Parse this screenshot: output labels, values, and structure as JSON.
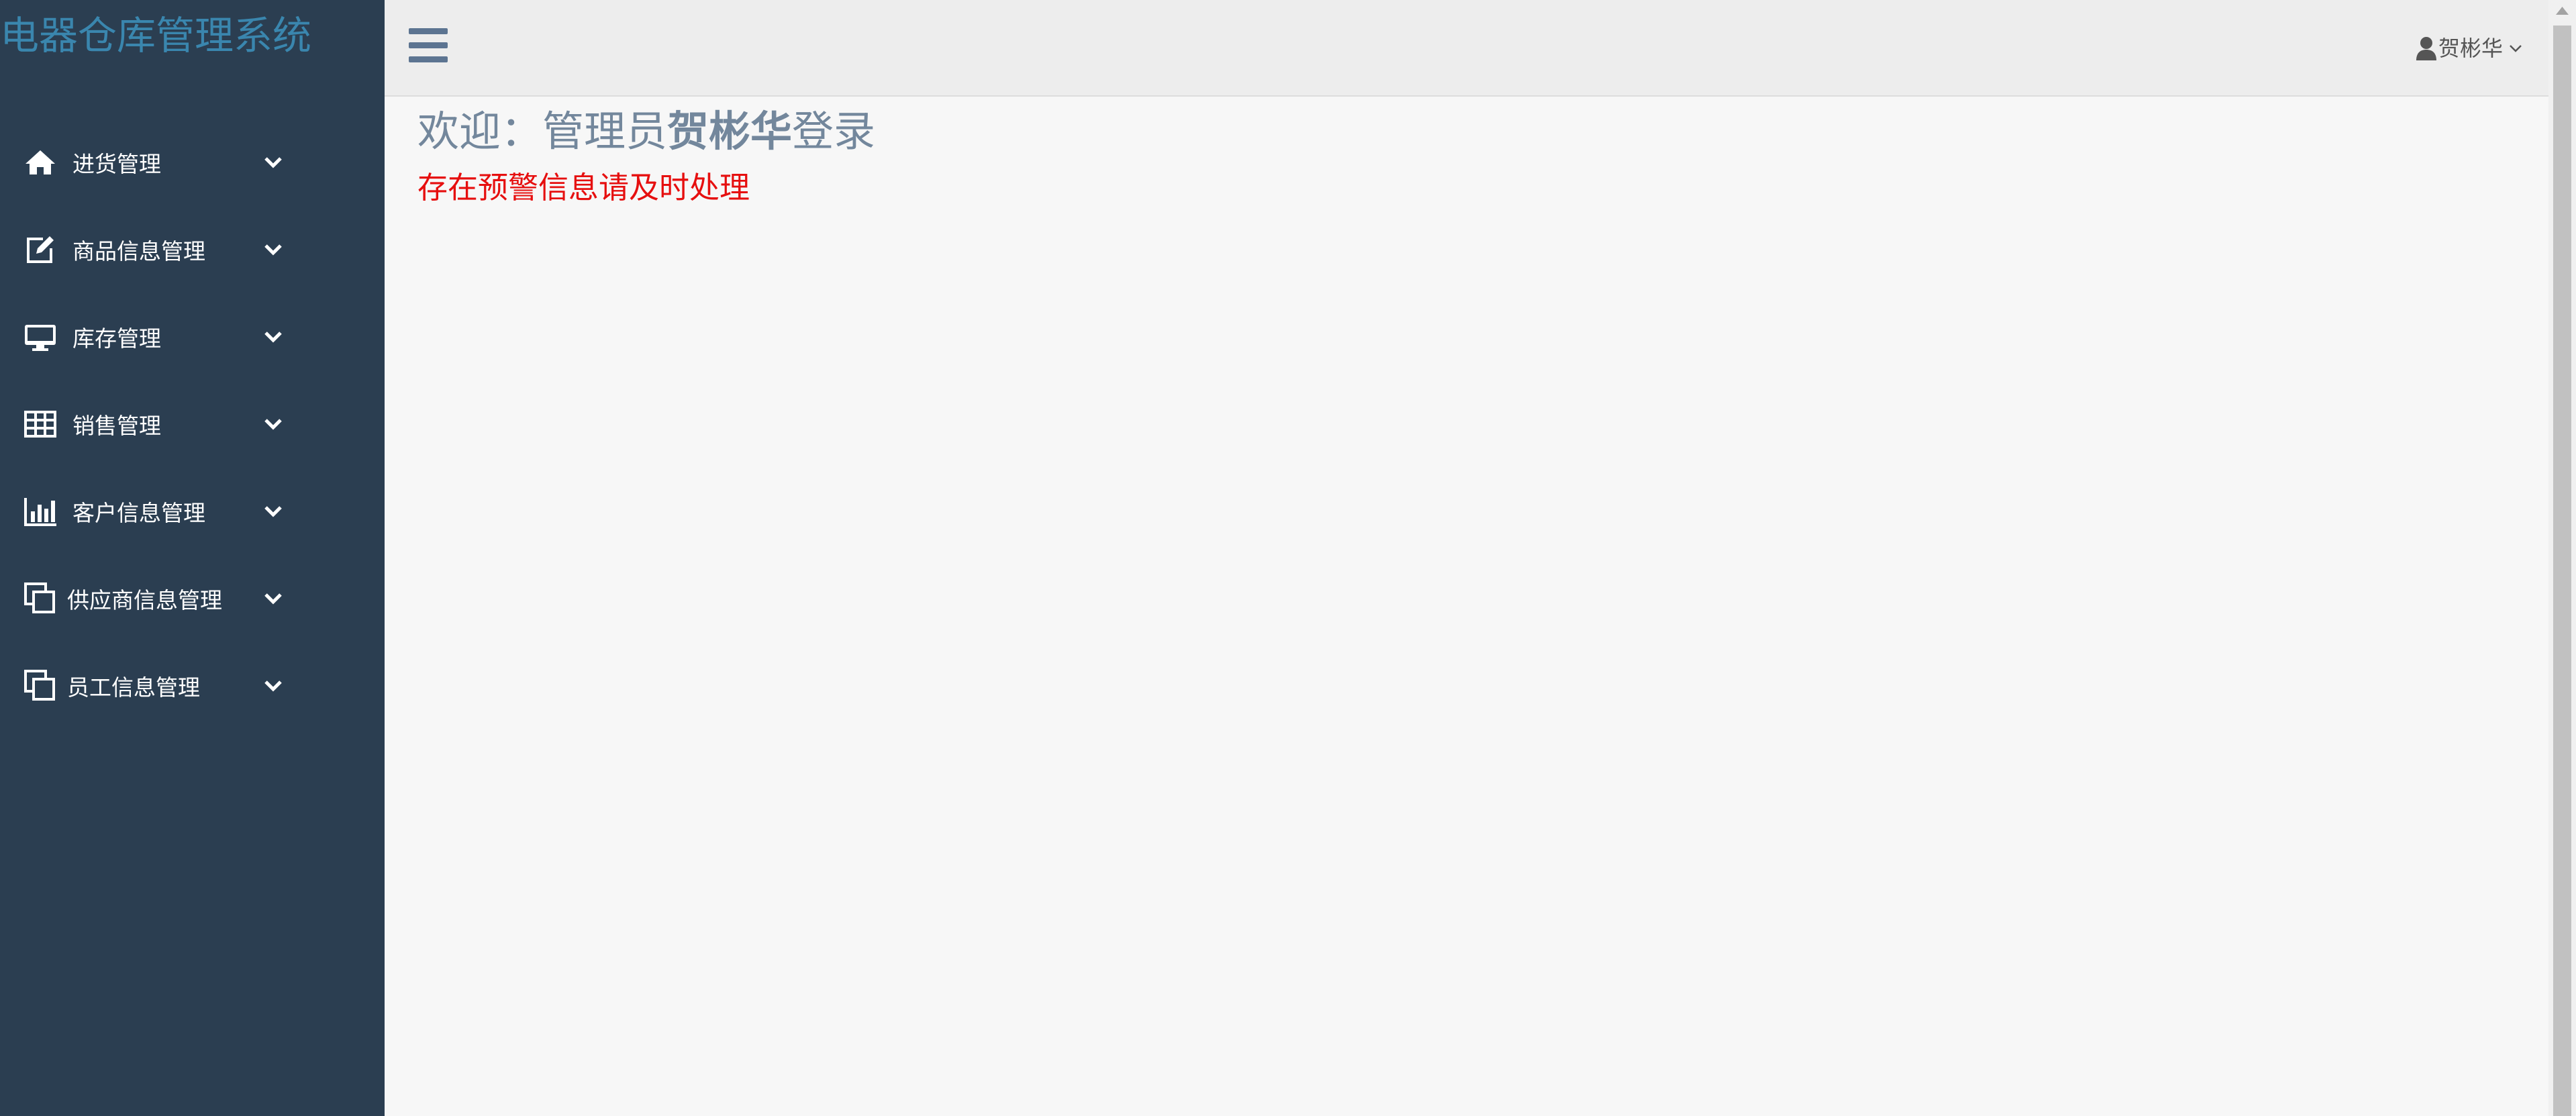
{
  "sidebar": {
    "brand": "电器仓库管理系统",
    "items": [
      {
        "label": "进货管理",
        "icon": "home-icon"
      },
      {
        "label": "商品信息管理",
        "icon": "edit-icon"
      },
      {
        "label": "库存管理",
        "icon": "desktop-icon"
      },
      {
        "label": "销售管理",
        "icon": "table-icon"
      },
      {
        "label": "客户信息管理",
        "icon": "bar-chart-icon"
      },
      {
        "label": "供应商信息管理",
        "icon": "clone-icon"
      },
      {
        "label": "员工信息管理",
        "icon": "clone-icon"
      }
    ]
  },
  "header": {
    "user_name": "贺彬华"
  },
  "main": {
    "welcome_prefix": "欢迎：管理员",
    "welcome_name": "贺彬华",
    "welcome_suffix": "登录",
    "warning": "存在预警信息请及时处理"
  },
  "colors": {
    "sidebar_bg": "#2b3e51",
    "brand": "#3a86ae",
    "warning": "#e60f0f",
    "welcome_text": "#73879c"
  }
}
